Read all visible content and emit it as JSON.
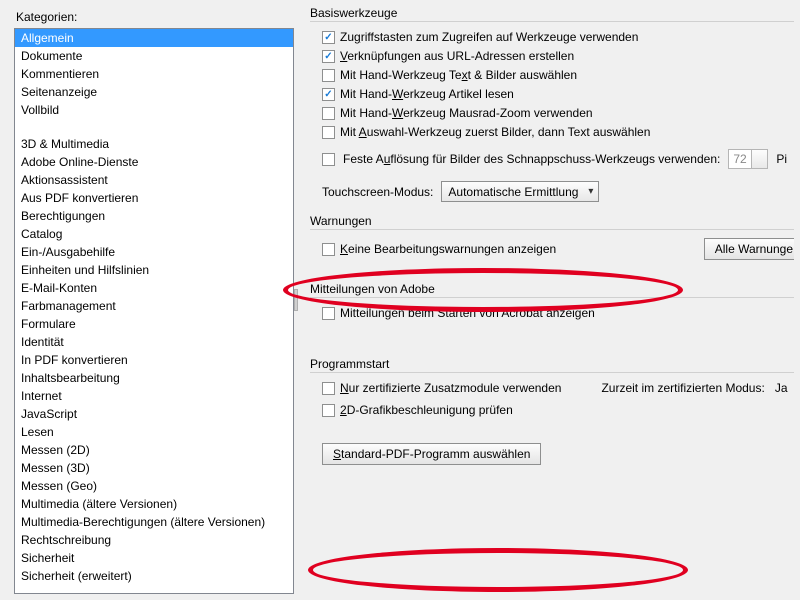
{
  "left": {
    "label": "Kategorien:",
    "selectedIndex": 0,
    "items": [
      "Allgemein",
      "Dokumente",
      "Kommentieren",
      "Seitenanzeige",
      "Vollbild",
      "",
      "3D & Multimedia",
      "Adobe Online-Dienste",
      "Aktionsassistent",
      "Aus PDF konvertieren",
      "Berechtigungen",
      "Catalog",
      "Ein-/Ausgabehilfe",
      "Einheiten und Hilfslinien",
      "E-Mail-Konten",
      "Farbmanagement",
      "Formulare",
      "Identität",
      "In PDF konvertieren",
      "Inhaltsbearbeitung",
      "Internet",
      "JavaScript",
      "Lesen",
      "Messen (2D)",
      "Messen (3D)",
      "Messen (Geo)",
      "Multimedia (ältere Versionen)",
      "Multimedia-Berechtigungen (ältere Versionen)",
      "Rechtschreibung",
      "Sicherheit",
      "Sicherheit (erweitert)"
    ]
  },
  "basis": {
    "title": "Basiswerkzeuge",
    "cb1": {
      "checked": true,
      "pre": "Zu",
      "u": "g",
      "post": "riffstasten zum Zugreifen auf Werkzeuge verwenden"
    },
    "cb2": {
      "checked": true,
      "pre": "",
      "u": "V",
      "post": "erknüpfungen aus URL-Adressen erstellen"
    },
    "cb3": {
      "checked": false,
      "pre": "Mit Hand-Werkzeug Te",
      "u": "x",
      "post": "t & Bilder auswählen"
    },
    "cb4": {
      "checked": true,
      "pre": "Mit Hand-",
      "u": "W",
      "post": "erkzeug Artikel lesen"
    },
    "cb5": {
      "checked": false,
      "pre": "Mit Hand-",
      "u": "W",
      "post": "erkzeug Mausrad-Zoom verwenden"
    },
    "cb6": {
      "checked": false,
      "pre": "Mit ",
      "u": "A",
      "post": "uswahl-Werkzeug zuerst Bilder, dann Text auswählen"
    },
    "cb7": {
      "checked": false,
      "pre": "Feste A",
      "u": "u",
      "post": "flösung für Bilder des Schnappschuss-Werkzeugs verwenden:"
    },
    "resVal": "72",
    "resUnit": "Pi",
    "tsLabel": "Touchscreen-Modus:",
    "tsValue": "Automatische Ermittlung"
  },
  "warn": {
    "title": "Warnungen",
    "cb": {
      "checked": false,
      "pre": "",
      "u": "K",
      "post": "eine Bearbeitungswarnungen anzeigen"
    },
    "btn": "Alle Warnunge"
  },
  "mitt": {
    "title": "Mitteilungen von Adobe",
    "cb": {
      "checked": false,
      "text": "Mitteilungen beim Starten von Acrobat anzeigen"
    }
  },
  "prog": {
    "title": "Programmstart",
    "cb1": {
      "checked": false,
      "pre": "",
      "u": "N",
      "post": "ur zertifizierte Zusatzmodule verwenden"
    },
    "statusLabel": "Zurzeit im zertifizierten Modus:",
    "statusValue": "Ja",
    "cb2": {
      "checked": false,
      "pre": "",
      "u": "2",
      "post": "D-Grafikbeschleunigung prüfen"
    },
    "btn": {
      "u": "S",
      "post": "tandard-PDF-Programm auswählen"
    }
  }
}
